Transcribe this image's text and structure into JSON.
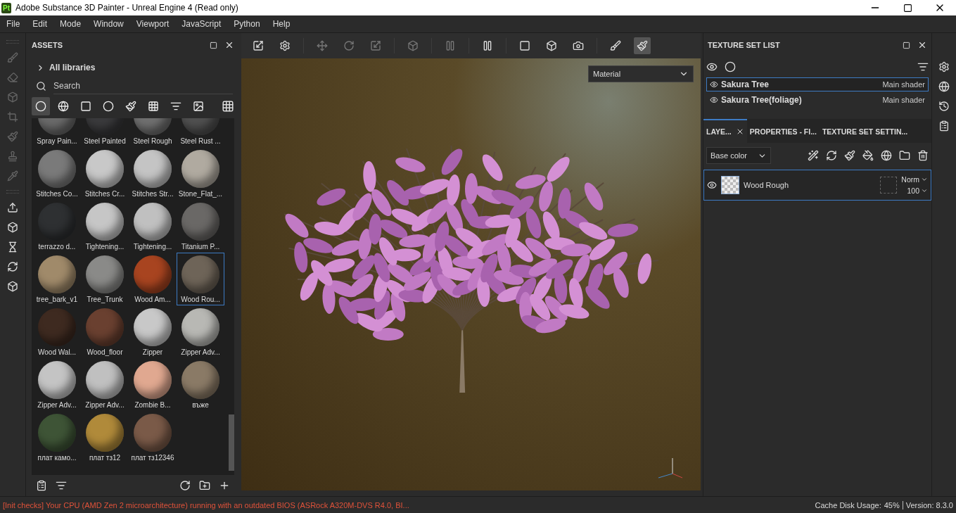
{
  "window": {
    "title": "Adobe Substance 3D Painter - Unreal Engine 4 (Read only)",
    "app_badge": "Pt"
  },
  "menu": [
    "File",
    "Edit",
    "Mode",
    "Window",
    "Viewport",
    "JavaScript",
    "Python",
    "Help"
  ],
  "assets": {
    "title": "ASSETS",
    "library": "All libraries",
    "search": {
      "placeholder": "Search"
    },
    "filters": [
      {
        "selected": true
      },
      {
        "selected": false
      },
      {
        "selected": false
      },
      {
        "selected": false
      },
      {
        "selected": false
      },
      {
        "selected": false
      },
      {
        "selected": false
      },
      {
        "selected": false
      }
    ],
    "items": [
      {
        "label": "Spray Pain...",
        "color": "#6a6a6a",
        "selected": false
      },
      {
        "label": "Steel Painted",
        "color": "#3a3a3c",
        "selected": false
      },
      {
        "label": "Steel Rough",
        "color": "#707070",
        "selected": false
      },
      {
        "label": "Steel Rust ...",
        "color": "#505050",
        "selected": false
      },
      {
        "label": "Stitches Co...",
        "color": "#7a7a7a",
        "selected": false
      },
      {
        "label": "Stitches Cr...",
        "color": "#c8c8c8",
        "selected": false
      },
      {
        "label": "Stitches Str...",
        "color": "#c4c4c4",
        "selected": false
      },
      {
        "label": "Stone_Flat_...",
        "color": "#b0aaa0",
        "selected": false
      },
      {
        "label": "terrazzo d...",
        "color": "#2e3032",
        "selected": false
      },
      {
        "label": "Tightening...",
        "color": "#c6c6c6",
        "selected": false
      },
      {
        "label": "Tightening...",
        "color": "#c0c0c0",
        "selected": false
      },
      {
        "label": "Titanium P...",
        "color": "#6a6866",
        "selected": false
      },
      {
        "label": "tree_bark_v1",
        "color": "#a08a6a",
        "selected": false
      },
      {
        "label": "Tree_Trunk",
        "color": "#8a8a88",
        "selected": false
      },
      {
        "label": "Wood Am...",
        "color": "#a84420",
        "selected": false
      },
      {
        "label": "Wood Rou...",
        "color": "#6e6458",
        "selected": true
      },
      {
        "label": "Wood Wal...",
        "color": "#3e2a20",
        "selected": false
      },
      {
        "label": "Wood_floor",
        "color": "#6a4030",
        "selected": false
      },
      {
        "label": "Zipper",
        "color": "#c8c8c8",
        "selected": false
      },
      {
        "label": "Zipper Adv...",
        "color": "#b8b8b4",
        "selected": false
      },
      {
        "label": "Zipper Adv...",
        "color": "#c4c4c4",
        "selected": false
      },
      {
        "label": "Zipper Adv...",
        "color": "#c0c0c0",
        "selected": false
      },
      {
        "label": "Zombie B...",
        "color": "#e0a890",
        "selected": false
      },
      {
        "label": "въже",
        "color": "#8a7a66",
        "selected": false
      },
      {
        "label": "плат камо...",
        "color": "#3e5436",
        "selected": false
      },
      {
        "label": "плат тз12",
        "color": "#b08a3a",
        "selected": false
      },
      {
        "label": "плат тз12346",
        "color": "#7a5a48",
        "selected": false
      }
    ]
  },
  "viewport": {
    "mode": "Material"
  },
  "texture_set_list": {
    "title": "TEXTURE SET LIST",
    "sets": [
      {
        "name": "Sakura Tree",
        "shader": "Main shader",
        "selected": true
      },
      {
        "name": "Sakura Tree(foliage)",
        "shader": "Main shader",
        "selected": false
      }
    ]
  },
  "layers_tabs": [
    {
      "label": "LAYE...",
      "selected": true
    },
    {
      "label": "PROPERTIES - FI...",
      "selected": false
    },
    {
      "label": "TEXTURE SET SETTIN...",
      "selected": false
    }
  ],
  "layers": {
    "channel": "Base color",
    "items": [
      {
        "name": "Wood Rough",
        "blend": "Norm",
        "opacity": "100",
        "selected": true
      }
    ]
  },
  "status_bar": {
    "message": "[Init checks] Your CPU (AMD Zen 2 microarchitecture) running with an outdated BIOS (ASRock A320M-DVS R4.0, BI...",
    "cache": "Cache Disk Usage:",
    "cache_value": "45%",
    "version": "Version: 8.3.0"
  }
}
